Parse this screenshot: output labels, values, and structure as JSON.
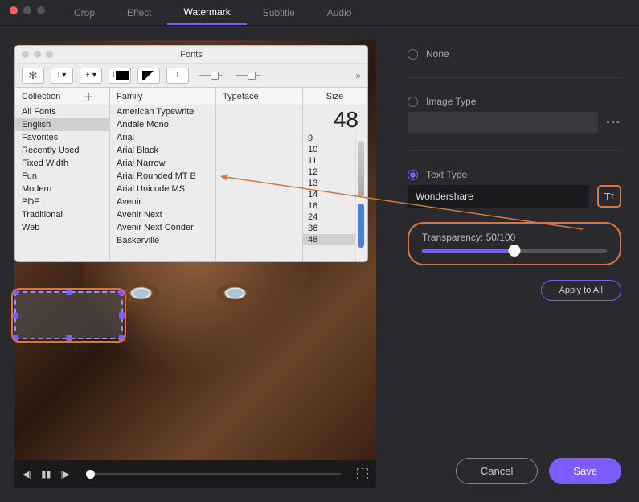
{
  "tabs": [
    "Crop",
    "Effect",
    "Watermark",
    "Subtitle",
    "Audio"
  ],
  "active_tab": "Watermark",
  "fonts_panel": {
    "title": "Fonts",
    "headers": {
      "collection": "Collection",
      "family": "Family",
      "typeface": "Typeface",
      "size": "Size"
    },
    "collections": [
      "All Fonts",
      "English",
      "Favorites",
      "Recently Used",
      "Fixed Width",
      "Fun",
      "Modern",
      "PDF",
      "Traditional",
      "Web"
    ],
    "selected_collection": "English",
    "families": [
      "American Typewrite",
      "Andale Mono",
      "Arial",
      "Arial Black",
      "Arial Narrow",
      "Arial Rounded MT B",
      "Arial Unicode MS",
      "Avenir",
      "Avenir Next",
      "Avenir Next Conder",
      "Baskerville"
    ],
    "sizes": [
      9,
      10,
      11,
      12,
      13,
      14,
      18,
      24,
      36,
      48
    ],
    "selected_size": 48,
    "current_size_display": "48"
  },
  "side_panel": {
    "none_label": "None",
    "image_type_label": "Image Type",
    "text_type_label": "Text Type",
    "text_value": "Wondershare",
    "transparency_label": "Transparency: 50/100",
    "transparency_pct": 50,
    "apply_all_label": "Apply to All",
    "cancel_label": "Cancel",
    "save_label": "Save"
  },
  "playbar": {
    "prev": "◀|",
    "pause": "▮▮",
    "next": "|▶"
  }
}
